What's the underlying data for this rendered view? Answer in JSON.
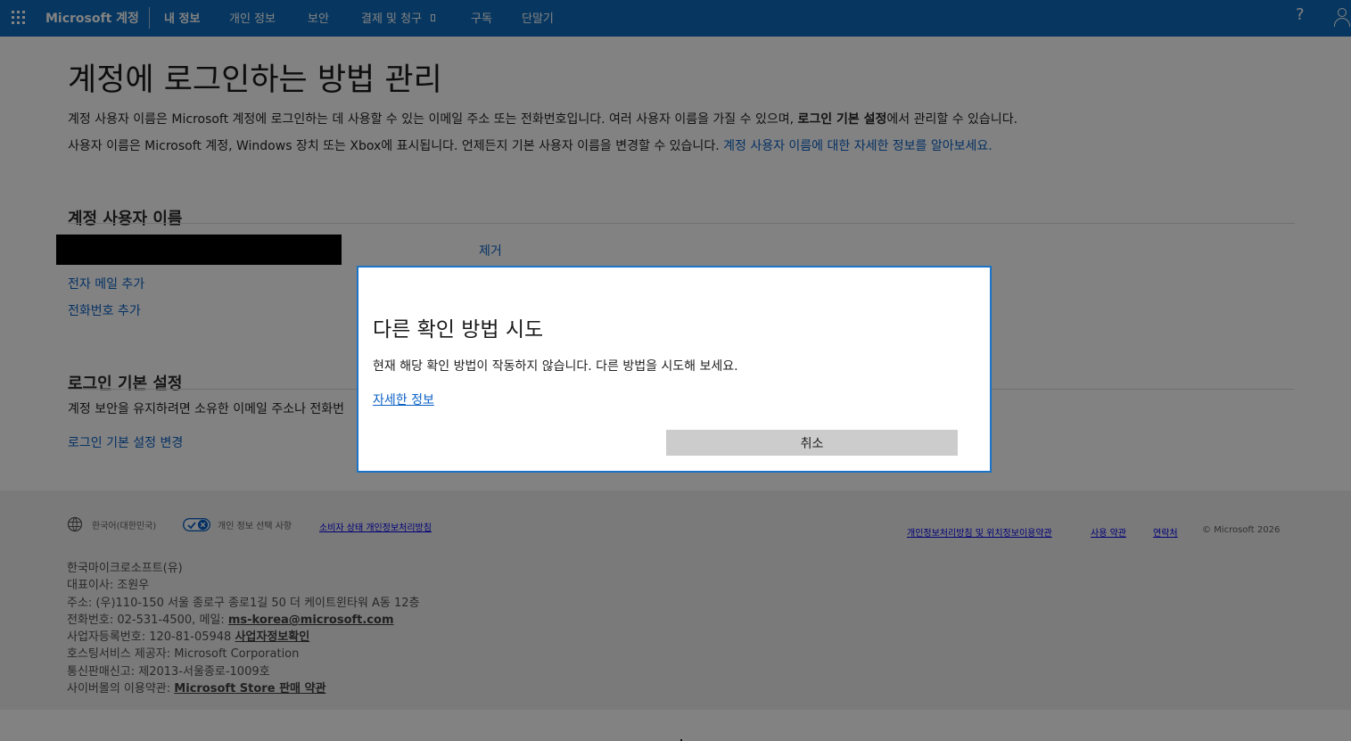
{
  "topnav": {
    "app_title": "Microsoft 계정",
    "items": [
      {
        "label": "내 정보",
        "active": true
      },
      {
        "label": "개인 정보"
      },
      {
        "label": "보안"
      },
      {
        "label": "결제 및 청구"
      },
      {
        "label": "구독"
      },
      {
        "label": "단말기"
      }
    ],
    "help_label": "?"
  },
  "page": {
    "title": "계정에 로그인하는 방법 관리",
    "description_1_prefix": "계정 사용자 이름은 Microsoft 계정에 로그인하는 데 사용할 수 있는 이메일 주소 또는 전화번호입니다. 여러 사용자 이름을 가질 수 있으며, ",
    "description_1_strong": "로그인 기본 설정",
    "description_1_suffix": "에서 관리할 수 있습니다.",
    "description_2_prefix": "사용자 이름은 Microsoft 계정, Windows 장치 또는 Xbox에 표시됩니다. 언제든지 기본 사용자 이름을 변경할 수 있습니다. ",
    "description_2_link": "계정 사용자 이름에 대한 자세한 정보를 알아보세요."
  },
  "account_usernames": {
    "heading": "계정 사용자 이름",
    "remove_label": "제거",
    "add_email_label": "전자 메일 추가",
    "add_phone_label": "전화번호 추가"
  },
  "login_preferences": {
    "heading": "로그인 기본 설정",
    "description_visible": "계정 보안을 유지하려면 소유한 이메일 주소나 전화번",
    "change_link": "로그인 기본 설정 변경"
  },
  "dialog": {
    "title": "다른 확인 방법 시도",
    "message": "현재 해당 확인 방법이 작동하지 않습니다. 다른 방법을 시도해 보세요.",
    "more_info_label": "자세한 정보",
    "cancel_label": "취소"
  },
  "footer": {
    "language_label": "한국어(대한민국)",
    "privacy_choices_label": "개인 정보 선택 사항",
    "consumer_privacy_label": "소비자 상태 개인정보처리방침",
    "privacy_location_label": "개인정보처리방침 및 위치정보이용약관",
    "terms_label": "사용 약관",
    "contact_label": "연락처",
    "copyright_label": "© Microsoft 2026",
    "company_name": "한국마이크로소프트(유)",
    "representative": "대표이사: 조원우",
    "address": "주소: (우)110-150 서울 종로구 종로1길 50 더 케이트윈타워 A동 12층",
    "phone_prefix": "전화번호: 02-531-4500, 메일: ",
    "email_link": "ms-korea@microsoft.com",
    "business_prefix": "사업자등록번호: 120-81-05948 ",
    "business_link": "사업자정보확인",
    "hosting": "호스팅서비스 제공자: Microsoft Corporation",
    "telecom": "통신판매신고: 제2013-서울종로-1009호",
    "terms_prefix": "사이버몰의 이용약관: ",
    "store_terms_link": "Microsoft Store 판매 약관"
  },
  "icons": {
    "waffle": "waffle-icon",
    "help": "help-icon",
    "avatar": "avatar-icon",
    "globe": "globe-icon",
    "privacy_toggle": "privacy-toggle-icon",
    "dropdown": "chevron-down-icon"
  },
  "colors": {
    "topbar": "#0f6cbd",
    "link": "#0b61c5",
    "dialog_border": "#1a73c8",
    "cancel_button": "#cccccc"
  }
}
